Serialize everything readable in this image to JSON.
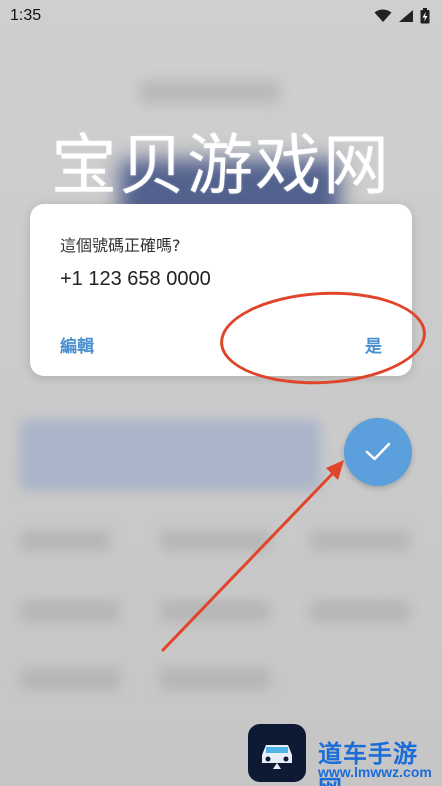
{
  "status_bar": {
    "time": "1:35"
  },
  "watermark": {
    "text": "宝贝游戏网"
  },
  "dialog": {
    "question": "這個號碼正確嗎?",
    "phone_number": "+1 123 658 0000",
    "edit_label": "編輯",
    "confirm_label": "是"
  },
  "fab": {
    "icon": "check-icon",
    "color": "#5b9fdc"
  },
  "site_logo": {
    "name": "道车手游网",
    "url": "www.lmwwz.com"
  },
  "colors": {
    "accent": "#4a90d0",
    "annotation": "#e0452a"
  }
}
